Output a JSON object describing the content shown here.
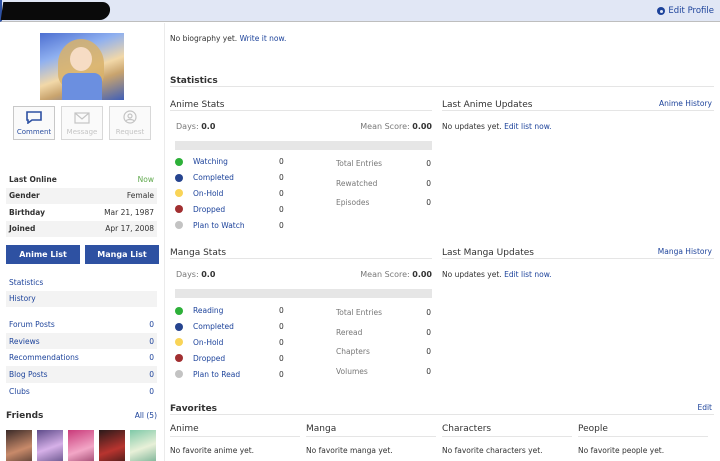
{
  "header": {
    "edit_profile": "Edit Profile"
  },
  "actions": [
    {
      "label": "Comment",
      "icon": "comment-icon",
      "enabled": true
    },
    {
      "label": "Message",
      "icon": "envelope-icon",
      "enabled": false
    },
    {
      "label": "Request",
      "icon": "friend-request-icon",
      "enabled": false
    }
  ],
  "info": {
    "last_online_label": "Last Online",
    "last_online_value": "Now",
    "gender_label": "Gender",
    "gender_value": "Female",
    "birthday_label": "Birthday",
    "birthday_value": "Mar 21, 1987",
    "joined_label": "Joined",
    "joined_value": "Apr 17, 2008"
  },
  "buttons": {
    "anime_list": "Anime List",
    "manga_list": "Manga List"
  },
  "nav": {
    "statistics": "Statistics",
    "history": "History"
  },
  "counts": [
    {
      "label": "Forum Posts",
      "value": "0"
    },
    {
      "label": "Reviews",
      "value": "0"
    },
    {
      "label": "Recommendations",
      "value": "0"
    },
    {
      "label": "Blog Posts",
      "value": "0"
    },
    {
      "label": "Clubs",
      "value": "0"
    }
  ],
  "friends": {
    "title": "Friends",
    "all": "All (5)"
  },
  "bio": {
    "text": "No biography yet.",
    "link": "Write it now."
  },
  "statistics": {
    "title": "Statistics",
    "anime": {
      "title": "Anime Stats",
      "days_label": "Days:",
      "days_value": "0.0",
      "mean_label": "Mean Score:",
      "mean_value": "0.00",
      "statuses": [
        {
          "label": "Watching",
          "value": "0",
          "color": "#2db039"
        },
        {
          "label": "Completed",
          "value": "0",
          "color": "#26448f"
        },
        {
          "label": "On-Hold",
          "value": "0",
          "color": "#f9d457"
        },
        {
          "label": "Dropped",
          "value": "0",
          "color": "#a12f31"
        },
        {
          "label": "Plan to Watch",
          "value": "0",
          "color": "#c3c3c3"
        }
      ],
      "totals": [
        {
          "label": "Total Entries",
          "value": "0"
        },
        {
          "label": "Rewatched",
          "value": "0"
        },
        {
          "label": "Episodes",
          "value": "0"
        }
      ],
      "updates_title": "Last Anime Updates",
      "history_link": "Anime History",
      "updates_text": "No updates yet.",
      "updates_link": "Edit list now."
    },
    "manga": {
      "title": "Manga Stats",
      "days_label": "Days:",
      "days_value": "0.0",
      "mean_label": "Mean Score:",
      "mean_value": "0.00",
      "statuses": [
        {
          "label": "Reading",
          "value": "0",
          "color": "#2db039"
        },
        {
          "label": "Completed",
          "value": "0",
          "color": "#26448f"
        },
        {
          "label": "On-Hold",
          "value": "0",
          "color": "#f9d457"
        },
        {
          "label": "Dropped",
          "value": "0",
          "color": "#a12f31"
        },
        {
          "label": "Plan to Read",
          "value": "0",
          "color": "#c3c3c3"
        }
      ],
      "totals": [
        {
          "label": "Total Entries",
          "value": "0"
        },
        {
          "label": "Reread",
          "value": "0"
        },
        {
          "label": "Chapters",
          "value": "0"
        },
        {
          "label": "Volumes",
          "value": "0"
        }
      ],
      "updates_title": "Last Manga Updates",
      "history_link": "Manga History",
      "updates_text": "No updates yet.",
      "updates_link": "Edit list now."
    }
  },
  "favorites": {
    "title": "Favorites",
    "edit": "Edit",
    "columns": [
      {
        "title": "Anime",
        "text": "No favorite anime yet."
      },
      {
        "title": "Manga",
        "text": "No favorite manga yet."
      },
      {
        "title": "Characters",
        "text": "No favorite characters yet."
      },
      {
        "title": "People",
        "text": "No favorite people yet."
      }
    ]
  }
}
